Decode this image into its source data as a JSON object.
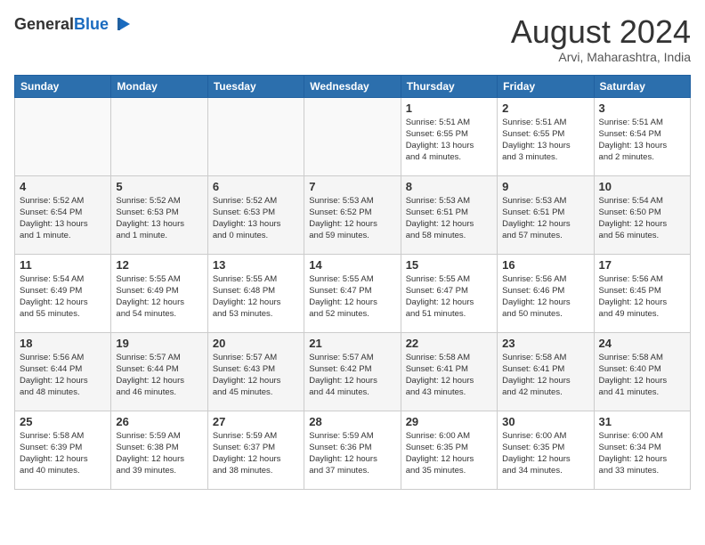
{
  "header": {
    "logo_general": "General",
    "logo_blue": "Blue",
    "month_title": "August 2024",
    "location": "Arvi, Maharashtra, India"
  },
  "days_of_week": [
    "Sunday",
    "Monday",
    "Tuesday",
    "Wednesday",
    "Thursday",
    "Friday",
    "Saturday"
  ],
  "weeks": [
    [
      {
        "day": "",
        "info": ""
      },
      {
        "day": "",
        "info": ""
      },
      {
        "day": "",
        "info": ""
      },
      {
        "day": "",
        "info": ""
      },
      {
        "day": "1",
        "info": "Sunrise: 5:51 AM\nSunset: 6:55 PM\nDaylight: 13 hours\nand 4 minutes."
      },
      {
        "day": "2",
        "info": "Sunrise: 5:51 AM\nSunset: 6:55 PM\nDaylight: 13 hours\nand 3 minutes."
      },
      {
        "day": "3",
        "info": "Sunrise: 5:51 AM\nSunset: 6:54 PM\nDaylight: 13 hours\nand 2 minutes."
      }
    ],
    [
      {
        "day": "4",
        "info": "Sunrise: 5:52 AM\nSunset: 6:54 PM\nDaylight: 13 hours\nand 1 minute."
      },
      {
        "day": "5",
        "info": "Sunrise: 5:52 AM\nSunset: 6:53 PM\nDaylight: 13 hours\nand 1 minute."
      },
      {
        "day": "6",
        "info": "Sunrise: 5:52 AM\nSunset: 6:53 PM\nDaylight: 13 hours\nand 0 minutes."
      },
      {
        "day": "7",
        "info": "Sunrise: 5:53 AM\nSunset: 6:52 PM\nDaylight: 12 hours\nand 59 minutes."
      },
      {
        "day": "8",
        "info": "Sunrise: 5:53 AM\nSunset: 6:51 PM\nDaylight: 12 hours\nand 58 minutes."
      },
      {
        "day": "9",
        "info": "Sunrise: 5:53 AM\nSunset: 6:51 PM\nDaylight: 12 hours\nand 57 minutes."
      },
      {
        "day": "10",
        "info": "Sunrise: 5:54 AM\nSunset: 6:50 PM\nDaylight: 12 hours\nand 56 minutes."
      }
    ],
    [
      {
        "day": "11",
        "info": "Sunrise: 5:54 AM\nSunset: 6:49 PM\nDaylight: 12 hours\nand 55 minutes."
      },
      {
        "day": "12",
        "info": "Sunrise: 5:55 AM\nSunset: 6:49 PM\nDaylight: 12 hours\nand 54 minutes."
      },
      {
        "day": "13",
        "info": "Sunrise: 5:55 AM\nSunset: 6:48 PM\nDaylight: 12 hours\nand 53 minutes."
      },
      {
        "day": "14",
        "info": "Sunrise: 5:55 AM\nSunset: 6:47 PM\nDaylight: 12 hours\nand 52 minutes."
      },
      {
        "day": "15",
        "info": "Sunrise: 5:55 AM\nSunset: 6:47 PM\nDaylight: 12 hours\nand 51 minutes."
      },
      {
        "day": "16",
        "info": "Sunrise: 5:56 AM\nSunset: 6:46 PM\nDaylight: 12 hours\nand 50 minutes."
      },
      {
        "day": "17",
        "info": "Sunrise: 5:56 AM\nSunset: 6:45 PM\nDaylight: 12 hours\nand 49 minutes."
      }
    ],
    [
      {
        "day": "18",
        "info": "Sunrise: 5:56 AM\nSunset: 6:44 PM\nDaylight: 12 hours\nand 48 minutes."
      },
      {
        "day": "19",
        "info": "Sunrise: 5:57 AM\nSunset: 6:44 PM\nDaylight: 12 hours\nand 46 minutes."
      },
      {
        "day": "20",
        "info": "Sunrise: 5:57 AM\nSunset: 6:43 PM\nDaylight: 12 hours\nand 45 minutes."
      },
      {
        "day": "21",
        "info": "Sunrise: 5:57 AM\nSunset: 6:42 PM\nDaylight: 12 hours\nand 44 minutes."
      },
      {
        "day": "22",
        "info": "Sunrise: 5:58 AM\nSunset: 6:41 PM\nDaylight: 12 hours\nand 43 minutes."
      },
      {
        "day": "23",
        "info": "Sunrise: 5:58 AM\nSunset: 6:41 PM\nDaylight: 12 hours\nand 42 minutes."
      },
      {
        "day": "24",
        "info": "Sunrise: 5:58 AM\nSunset: 6:40 PM\nDaylight: 12 hours\nand 41 minutes."
      }
    ],
    [
      {
        "day": "25",
        "info": "Sunrise: 5:58 AM\nSunset: 6:39 PM\nDaylight: 12 hours\nand 40 minutes."
      },
      {
        "day": "26",
        "info": "Sunrise: 5:59 AM\nSunset: 6:38 PM\nDaylight: 12 hours\nand 39 minutes."
      },
      {
        "day": "27",
        "info": "Sunrise: 5:59 AM\nSunset: 6:37 PM\nDaylight: 12 hours\nand 38 minutes."
      },
      {
        "day": "28",
        "info": "Sunrise: 5:59 AM\nSunset: 6:36 PM\nDaylight: 12 hours\nand 37 minutes."
      },
      {
        "day": "29",
        "info": "Sunrise: 6:00 AM\nSunset: 6:35 PM\nDaylight: 12 hours\nand 35 minutes."
      },
      {
        "day": "30",
        "info": "Sunrise: 6:00 AM\nSunset: 6:35 PM\nDaylight: 12 hours\nand 34 minutes."
      },
      {
        "day": "31",
        "info": "Sunrise: 6:00 AM\nSunset: 6:34 PM\nDaylight: 12 hours\nand 33 minutes."
      }
    ]
  ]
}
